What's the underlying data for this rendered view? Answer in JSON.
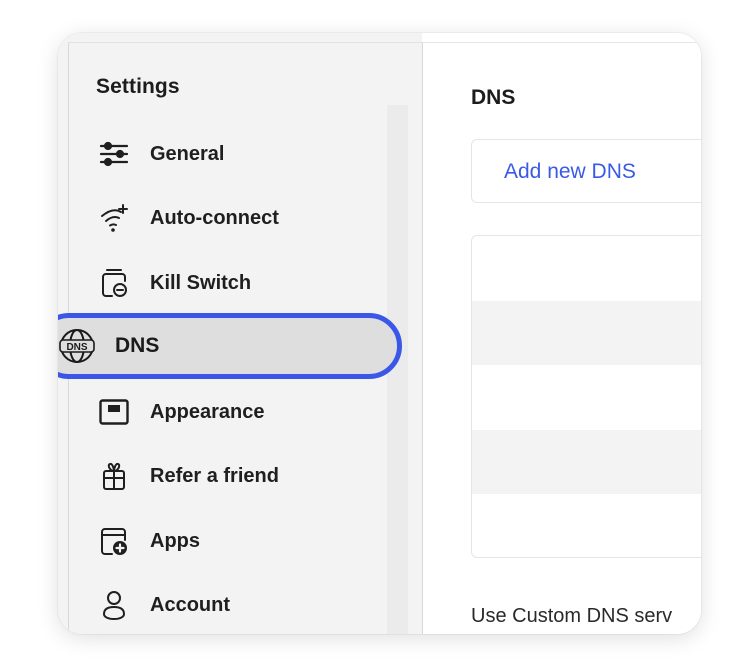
{
  "sidebar": {
    "title": "Settings",
    "items": [
      {
        "label": "General",
        "icon": "sliders-icon"
      },
      {
        "label": "Auto-connect",
        "icon": "wifi-sparkle-icon"
      },
      {
        "label": "Kill Switch",
        "icon": "kill-switch-icon"
      },
      {
        "label": "DNS",
        "icon": "dns-globe-icon",
        "selected": true
      },
      {
        "label": "Appearance",
        "icon": "appearance-icon"
      },
      {
        "label": "Refer a friend",
        "icon": "gift-icon"
      },
      {
        "label": "Apps",
        "icon": "apps-icon"
      },
      {
        "label": "Account",
        "icon": "account-icon"
      }
    ]
  },
  "main": {
    "title": "DNS",
    "add_button": "Add new DNS",
    "footer_text": "Use Custom DNS serv"
  },
  "colors": {
    "accent": "#3b57e8",
    "link": "#3a5ae6",
    "sidebar_bg": "#f3f3f3",
    "selected_bg": "#dedede"
  }
}
